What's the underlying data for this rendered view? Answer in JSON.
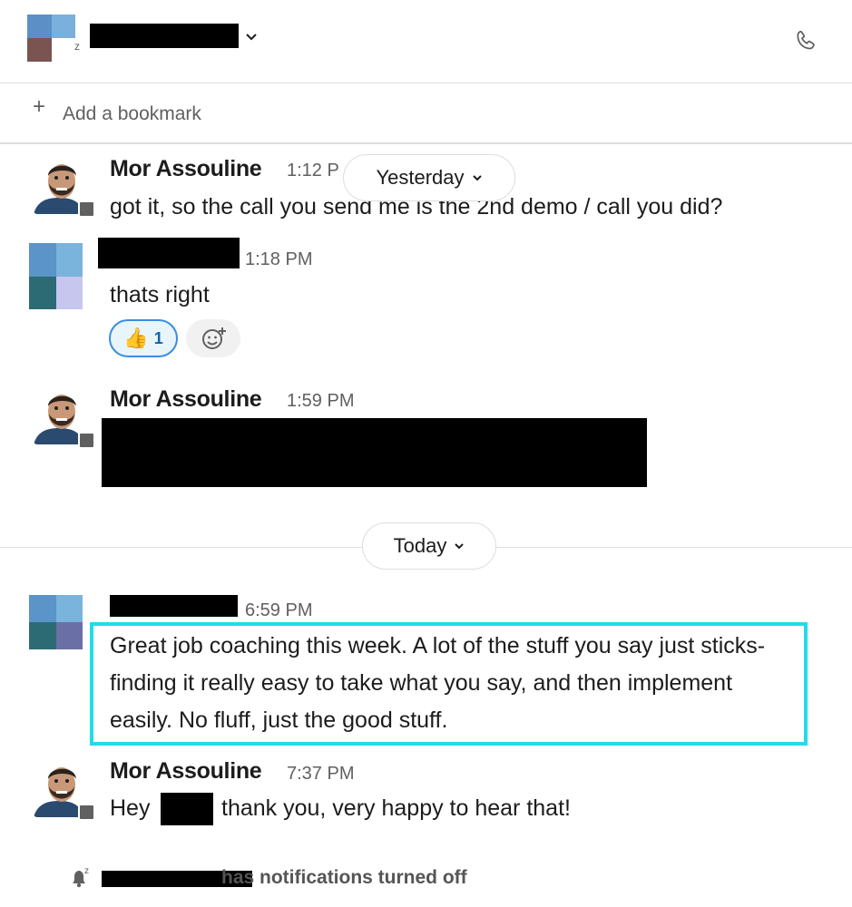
{
  "header": {
    "channel_name": "",
    "chevron_icon": "chevron-down-icon",
    "call_icon": "phone-icon"
  },
  "bookmarks": {
    "plus": "+",
    "label": "Add a bookmark"
  },
  "day_dividers": {
    "yesterday": "Yesterday",
    "today": "Today",
    "chevron": "⌄"
  },
  "messages": [
    {
      "author": "Mor Assouline",
      "time": "1:12 P",
      "text": "got it, so the call you send me is the 2nd demo / call you did?"
    },
    {
      "author": "",
      "time": "1:18 PM",
      "text": "thats right",
      "reaction": {
        "emoji": "👍",
        "count": "1"
      }
    },
    {
      "author": "Mor Assouline",
      "time": "1:59 PM",
      "text": ""
    },
    {
      "author": "",
      "time": "6:59 PM",
      "text": "Great job coaching this week. A lot of the stuff you say just sticks- finding it really easy to take what you say, and then implement easily. No fluff, just the good stuff."
    },
    {
      "author": "Mor Assouline",
      "time": "7:37 PM",
      "text_before": "Hey",
      "text_after": "thank you, very happy to hear that!"
    }
  ],
  "footer": {
    "text": "has notifications turned off",
    "icon": "bell-snooze-icon"
  },
  "colors": {
    "highlight": "#20dcea",
    "reaction_border": "#3a8ee0",
    "reaction_bg": "#e8f5fa"
  }
}
